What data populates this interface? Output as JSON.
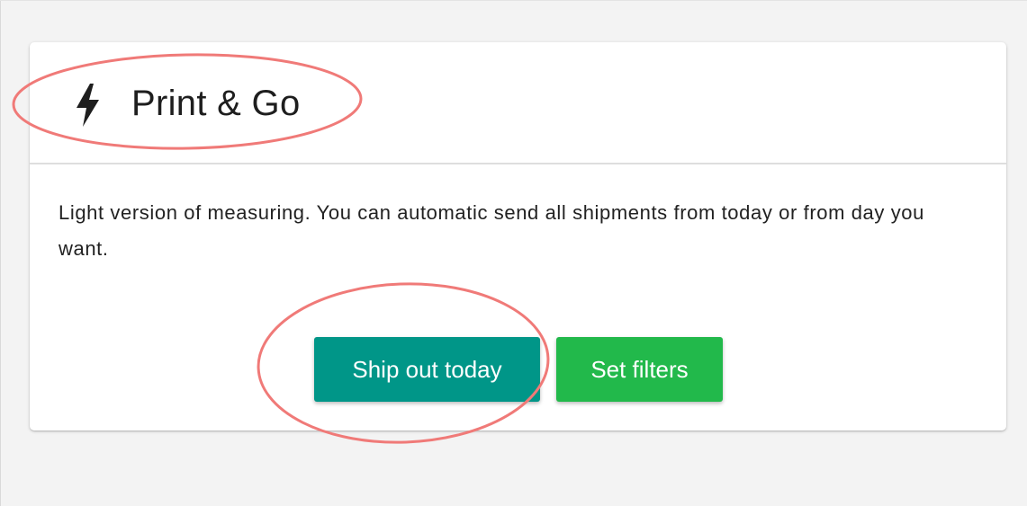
{
  "card": {
    "title": "Print & Go",
    "icon": "lightning-bolt-icon",
    "description": "Light version of measuring. You can automatic send all shipments from today or from day you want."
  },
  "actions": {
    "ship_out_today_label": "Ship out today",
    "set_filters_label": "Set filters"
  },
  "colors": {
    "page_background": "#f3f3f3",
    "card_background": "#ffffff",
    "ship_button": "#009688",
    "filters_button": "#22b94b",
    "annotation_ellipse": "#f07a78"
  }
}
